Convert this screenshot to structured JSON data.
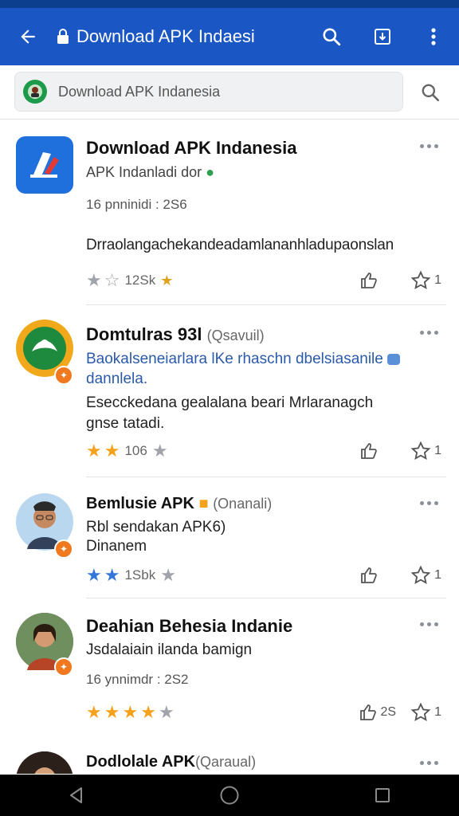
{
  "app_bar": {
    "title": "Download APK Indaesi",
    "icons": [
      "back-arrow-icon",
      "lock-icon",
      "search-icon",
      "download-icon",
      "more-vert-icon"
    ]
  },
  "search": {
    "text": "Download APK Indanesia",
    "icons": [
      "site-logo-icon",
      "search-icon"
    ]
  },
  "posts": [
    {
      "title": "Download APK Indanesia",
      "subtitle": "APK Indanladi dor",
      "meta": "16 pnninidi : 2S6",
      "body": "Drraolangachekandeadamlananhladupaonslan",
      "count": "12Sk",
      "rating_stars": 2,
      "rating_color": "#a0a4aa",
      "share_count": "1"
    },
    {
      "title": "Domtulras 93l",
      "title_muted": "(Qsavuil)",
      "text_a": "Baokalseneiarlara lKe rhaschn dbelsiasanile",
      "text_b": "dannlela.",
      "text_c": "Esecckedana gealalana beari Mrlaranagch",
      "text_d": "gnse tatadi.",
      "count": "106",
      "rating_stars": 2,
      "rating_color": "#f4a21c",
      "share_count": "1"
    },
    {
      "title": "Bemlusie APK",
      "title_muted": "(Onanali)",
      "text_a": "Rbl sendakan APK6)",
      "text_b": "Dinanem",
      "count": "1Sbk",
      "rating_stars": 2,
      "rating_color": "#3378d8",
      "share_count": "1"
    },
    {
      "title": "Deahian Behesia Indanie",
      "text_a": "Jsdalaiain ilanda bamign",
      "meta": "16 ynnimdr : 2S2",
      "rating_stars": 4,
      "rating_color": "#f4a21c",
      "reply_count": "2S",
      "share_count": "1"
    },
    {
      "title": "Dodlolale APK",
      "title_muted": "(Qaraual)"
    }
  ],
  "nav": {
    "icons": [
      "back-triangle-icon",
      "home-circle-icon",
      "recents-square-icon"
    ]
  }
}
